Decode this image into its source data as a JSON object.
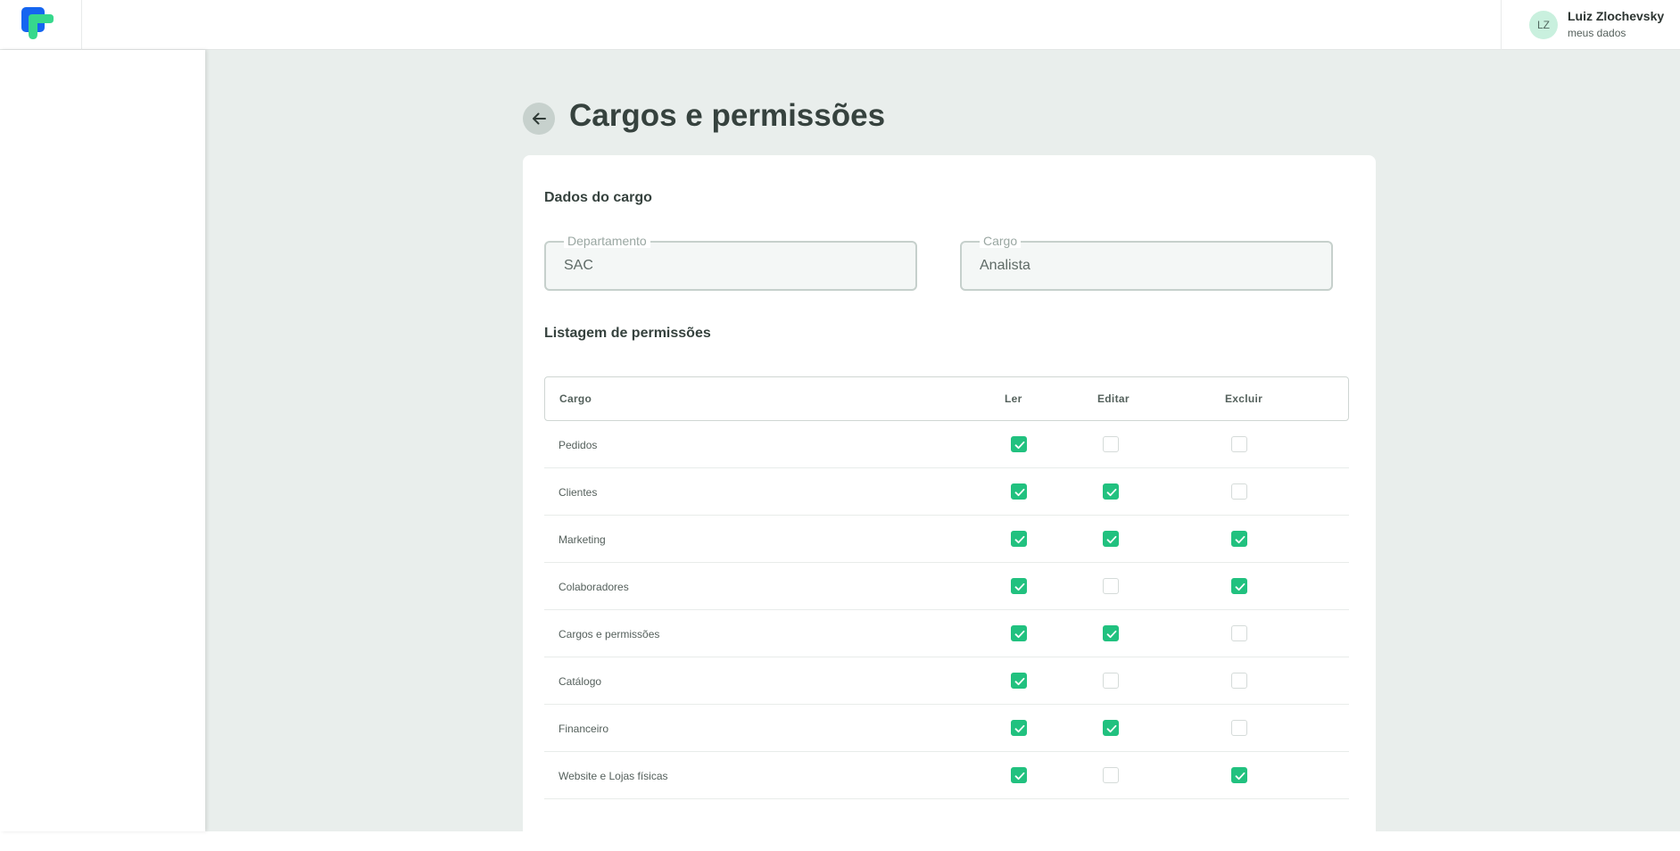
{
  "header": {
    "logo": "app-logo",
    "user": {
      "initials": "LZ",
      "name": "Luiz Zlochevsky",
      "link": "meus dados"
    }
  },
  "page": {
    "title": "Cargos e permissões",
    "back_icon": "arrow-left-icon"
  },
  "cargo_section": {
    "title": "Dados do cargo",
    "departamento": {
      "label": "Departamento",
      "value": "SAC"
    },
    "cargo": {
      "label": "Cargo",
      "value": "Analista"
    }
  },
  "permissions": {
    "title": "Listagem de permissões",
    "columns": [
      "Cargo",
      "Ler",
      "Editar",
      "Excluir"
    ],
    "rows": [
      {
        "name": "Pedidos",
        "ler": true,
        "editar": false,
        "excluir": false
      },
      {
        "name": "Clientes",
        "ler": true,
        "editar": true,
        "excluir": false
      },
      {
        "name": "Marketing",
        "ler": true,
        "editar": true,
        "excluir": true
      },
      {
        "name": "Colaboradores",
        "ler": true,
        "editar": false,
        "excluir": true
      },
      {
        "name": "Cargos e permissões",
        "ler": true,
        "editar": true,
        "excluir": false
      },
      {
        "name": "Catálogo",
        "ler": true,
        "editar": false,
        "excluir": false
      },
      {
        "name": "Financeiro",
        "ler": true,
        "editar": true,
        "excluir": false
      },
      {
        "name": "Website e Lojas físicas",
        "ler": true,
        "editar": false,
        "excluir": true
      }
    ]
  },
  "colors": {
    "accent": "#21c17f",
    "background": "#e9eeec",
    "title": "#36423e"
  }
}
